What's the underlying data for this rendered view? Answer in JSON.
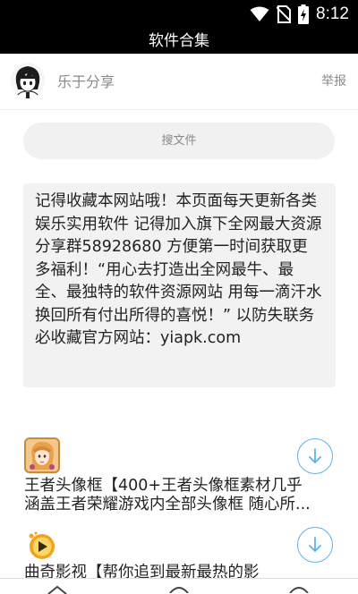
{
  "status_bar": {
    "time": "8:12"
  },
  "header": {
    "title": "软件合集"
  },
  "user": {
    "name": "乐于分享",
    "report_label": "举报"
  },
  "search": {
    "placeholder": "搜文件"
  },
  "notice": {
    "text": "记得收藏本网站哦！本页面每天更新各类娱乐实用软件 记得加入旗下全网最大资源分享群58928680 方便第一时间获取更多福利！“用心去打造出全网最牛、最全、最独特的软件资源网站 用每一滴汗水换回所有付出所得的喜悦！” 以防失联务必收藏官方网站：yiapk.com"
  },
  "apps": [
    {
      "title": "王者头像框【400+王者头像框素材几乎涵盖王者荣耀游戏内全部头像框 随心所...",
      "icon": "game-character-icon"
    },
    {
      "title": "曲奇影视【帮你追到最新最热的影",
      "icon": "cookie-video-icon"
    }
  ],
  "colors": {
    "accent": "#59b4e8",
    "header_bg": "#000000",
    "card_bg": "#f2f2f2"
  }
}
